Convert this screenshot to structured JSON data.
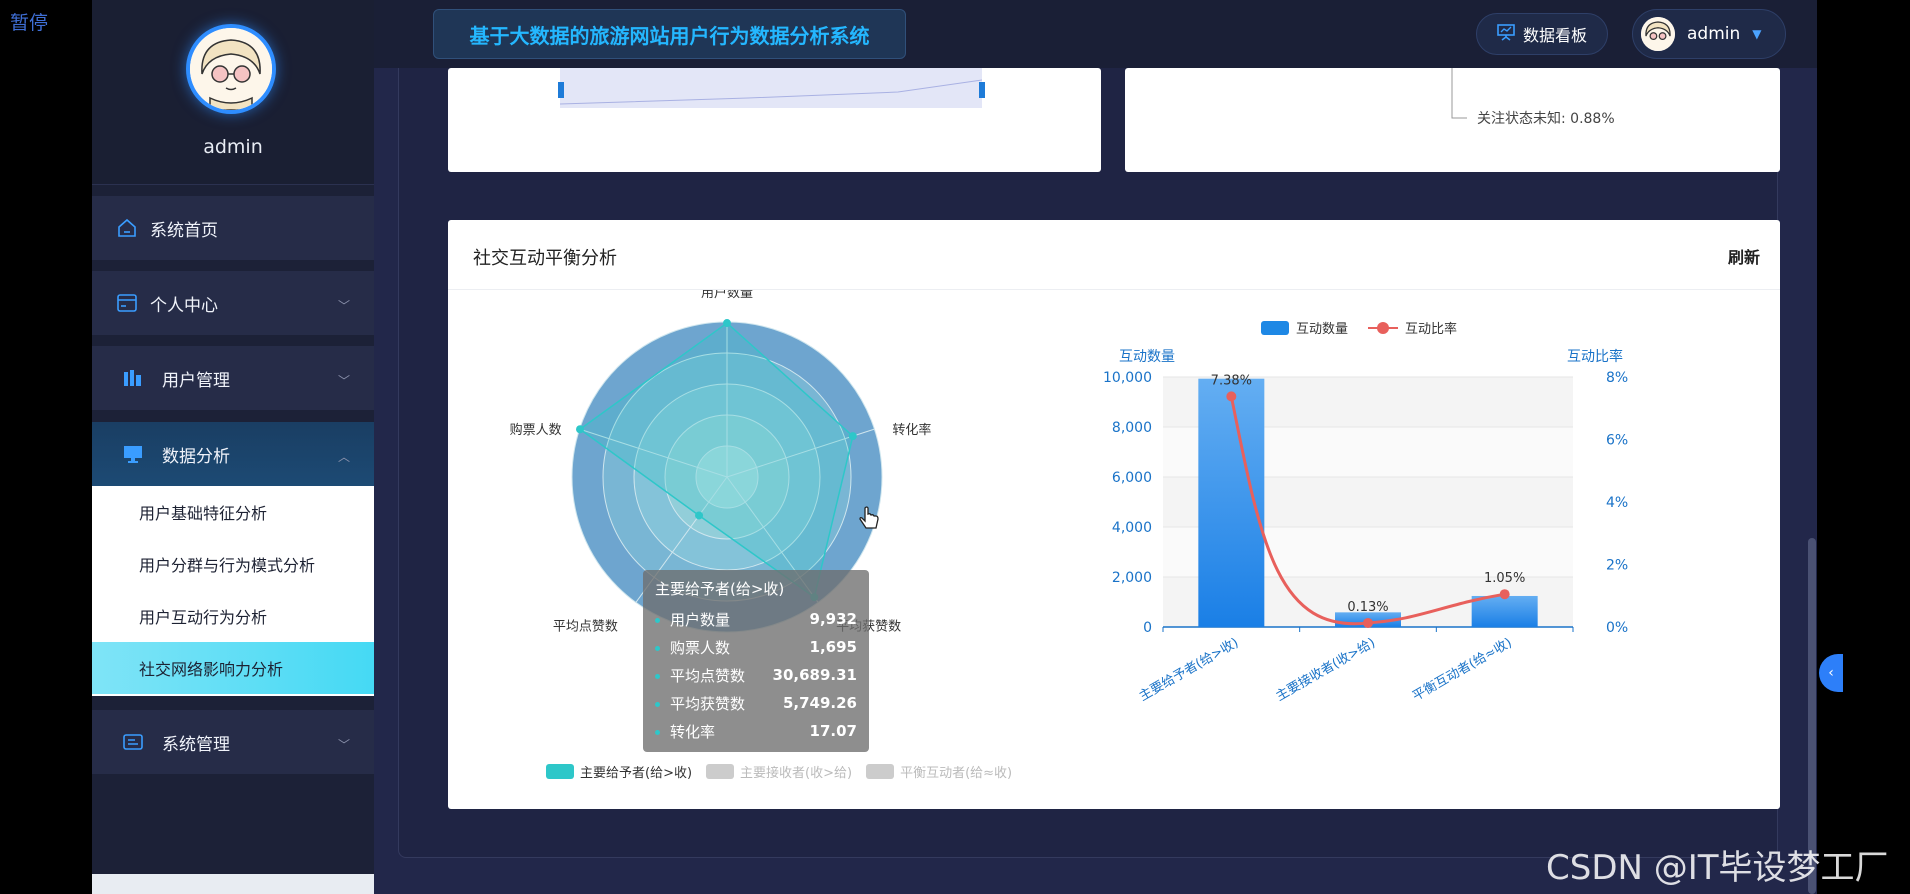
{
  "overlay": {
    "pause_label": "暂停",
    "watermark": "CSDN @IT毕设梦工厂"
  },
  "sidebar": {
    "username": "admin",
    "menu": [
      {
        "label": "系统首页",
        "icon": "home-icon"
      },
      {
        "label": "个人中心",
        "icon": "id-card-icon"
      },
      {
        "label": "用户管理",
        "icon": "bar-icon"
      },
      {
        "label": "数据分析",
        "icon": "monitor-icon"
      },
      {
        "label": "系统管理",
        "icon": "form-icon"
      }
    ],
    "submenu": [
      "用户基础特征分析",
      "用户分群与行为模式分析",
      "用户互动行为分析",
      "社交网络影响力分析"
    ]
  },
  "topbar": {
    "title": "基于大数据的旅游网站用户行为数据分析系统",
    "dashboard_label": "数据看板",
    "user": "admin"
  },
  "prev_card": {
    "pie_label": "关注状态未知: 0.88%"
  },
  "card": {
    "title": "社交互动平衡分析",
    "refresh": "刷新"
  },
  "colors": {
    "primary": "#2ec7c9",
    "bar": "#1e88e5",
    "line": "#e8605c",
    "title": "#24b7ff"
  },
  "chart_data": [
    {
      "type": "radar",
      "indicators": [
        "用户数量",
        "转化率",
        "平均获赞数",
        "平均点赞数",
        "购票人数"
      ],
      "legend": [
        "主要给予者(给>收)",
        "主要接收者(收>给)",
        "平衡互动者(给≈收)"
      ],
      "series": [
        {
          "name": "主要给予者(给>收)",
          "values": [
            9932,
            17.07,
            5749.26,
            30689.31,
            1695
          ]
        }
      ],
      "tooltip": {
        "title": "主要给予者(给>收)",
        "rows": [
          {
            "label": "用户数量",
            "value": "9,932"
          },
          {
            "label": "购票人数",
            "value": "1,695"
          },
          {
            "label": "平均点赞数",
            "value": "30,689.31"
          },
          {
            "label": "平均获赞数",
            "value": "5,749.26"
          },
          {
            "label": "转化率",
            "value": "17.07"
          }
        ]
      }
    },
    {
      "type": "bar",
      "categories": [
        "主要给予者(给>收)",
        "主要接收者(收>给)",
        "平衡互动者(给≈收)"
      ],
      "legend": [
        "互动数量",
        "互动比率"
      ],
      "ylabel": "互动数量",
      "ylabel_right": "互动比率",
      "ylim": [
        0,
        10000
      ],
      "ylim_right": [
        0,
        8
      ],
      "yticks": [
        "0",
        "2,000",
        "4,000",
        "6,000",
        "8,000",
        "10,000"
      ],
      "yticks_right": [
        "0%",
        "2%",
        "4%",
        "6%",
        "8%"
      ],
      "series": [
        {
          "name": "互动数量",
          "type": "bar",
          "values": [
            9932,
            586,
            1241
          ]
        },
        {
          "name": "互动比率",
          "type": "line",
          "values": [
            7.38,
            0.13,
            1.05
          ],
          "labels": [
            "7.38%",
            "0.13%",
            "1.05%"
          ]
        }
      ]
    }
  ]
}
